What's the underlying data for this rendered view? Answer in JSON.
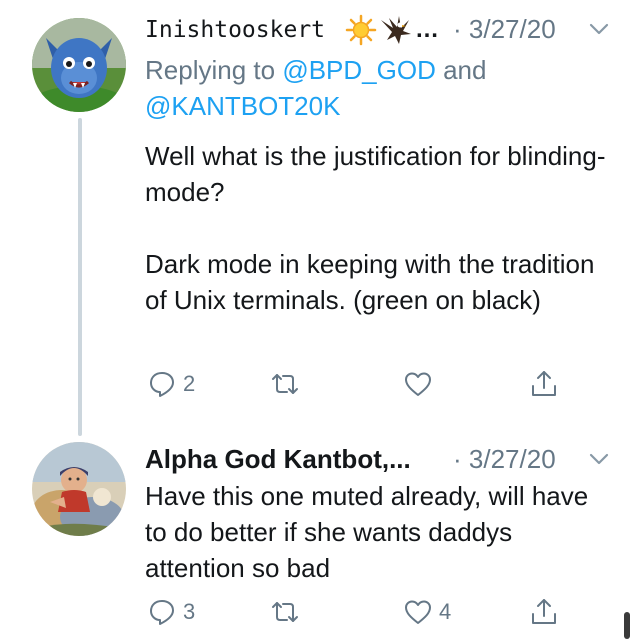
{
  "tweets": [
    {
      "author_name": "Inishtooskert",
      "name_suffix": "…",
      "emojis": [
        "sun-icon",
        "eagle-icon"
      ],
      "separator": "·",
      "date": "3/27/20",
      "reply_prefix": "Replying to",
      "reply_mention_1": "@BPD_GOD",
      "reply_conjunction": "and",
      "reply_mention_2": "@KANTBOT20K",
      "text_line_1": "Well what is the justification for blinding-mode?",
      "text_line_2": "Dark mode in keeping with the tradition of Unix terminals. (green on black)",
      "reply_count": "2",
      "retweet_count": "",
      "like_count": ""
    },
    {
      "author_name": "Alpha God Kantbot,...",
      "separator": "·",
      "date": "3/27/20",
      "text_line_1": "Have this one muted already, will have to do better if she wants daddys attention so bad",
      "reply_count": "3",
      "retweet_count": "",
      "like_count": "4"
    }
  ],
  "colors": {
    "text": "#14171a",
    "muted": "#657786",
    "link": "#1da1f2",
    "thread_line": "#ccd6dd"
  }
}
